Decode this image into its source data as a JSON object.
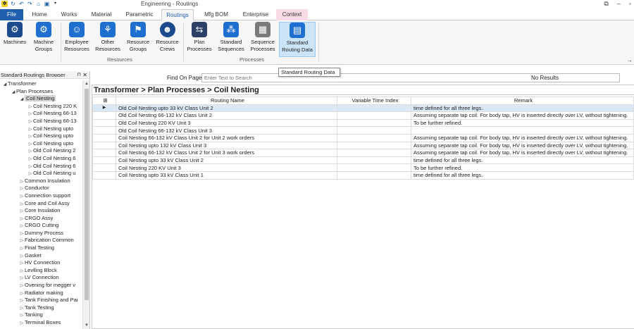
{
  "window": {
    "title": "Engineering - Routings"
  },
  "ribbon_tabs": [
    "File",
    "Home",
    "Works",
    "Material",
    "Parametric",
    "Routings",
    "Mfg BOM",
    "Enterprise",
    "Context"
  ],
  "ribbon": {
    "buttons": [
      {
        "label1": "Machines",
        "label2": "",
        "icon": "machines-icon",
        "color": "#1c4a8c"
      },
      {
        "label1": "Machine",
        "label2": "Groups",
        "icon": "machine-groups-icon",
        "color": "#1f6fd1"
      },
      {
        "label1": "Employee",
        "label2": "Resources",
        "icon": "employee-icon",
        "color": "#1f6fd1"
      },
      {
        "label1": "Other",
        "label2": "Resources",
        "icon": "other-resources-icon",
        "color": "#1f6fd1"
      },
      {
        "label1": "Resource",
        "label2": "Groups",
        "icon": "resource-groups-icon",
        "color": "#1f6fd1"
      },
      {
        "label1": "Resource",
        "label2": "Crews",
        "icon": "crews-icon",
        "color": "#1c4a8c"
      },
      {
        "label1": "Plan",
        "label2": "Processes",
        "icon": "plan-icon",
        "color": "#2e3f66"
      },
      {
        "label1": "Standard",
        "label2": "Sequences",
        "icon": "sequences-icon",
        "color": "#1f6fd1"
      },
      {
        "label1": "Sequence",
        "label2": "Processes",
        "icon": "sequence-processes-icon",
        "color": "#7a7a7a"
      },
      {
        "label1": "Standard",
        "label2": "Routing Data",
        "icon": "routing-data-icon",
        "color": "#1f6fd1"
      }
    ],
    "groups": [
      "Resources",
      "Processes"
    ]
  },
  "tooltip": "Standard Routing Data",
  "left_panel": {
    "title": "Standard Routings Browser",
    "tree": [
      {
        "label": "Transformer",
        "level": 0,
        "expanded": true
      },
      {
        "label": "Plan Processes",
        "level": 1,
        "expanded": true
      },
      {
        "label": "Coil Nesting",
        "level": 2,
        "expanded": true,
        "selected": true
      },
      {
        "label": "Coil Nesting 220 K",
        "level": 3
      },
      {
        "label": "Coil Nesting 66-13",
        "level": 3
      },
      {
        "label": "Coil Nesting 66-13",
        "level": 3
      },
      {
        "label": "Coil Nesting upto",
        "level": 3
      },
      {
        "label": "Coil Nesting upto",
        "level": 3
      },
      {
        "label": "Coil Nesting upto",
        "level": 3
      },
      {
        "label": "Old Coil Nesting 2",
        "level": 3
      },
      {
        "label": "Old Coil Nesting 6",
        "level": 3
      },
      {
        "label": "Old Coil Nesting 6",
        "level": 3
      },
      {
        "label": "Old Coil Nesting u",
        "level": 3
      },
      {
        "label": "Common Insulation",
        "level": 2
      },
      {
        "label": "Conductor",
        "level": 2
      },
      {
        "label": "Connection support",
        "level": 2
      },
      {
        "label": "Core and Coil Assy",
        "level": 2
      },
      {
        "label": "Core Insulation",
        "level": 2
      },
      {
        "label": "CRGO Assy",
        "level": 2
      },
      {
        "label": "CRGO Cutting",
        "level": 2
      },
      {
        "label": "Dummy Process",
        "level": 2
      },
      {
        "label": "Fabrication Common",
        "level": 2
      },
      {
        "label": "Final Testing",
        "level": 2
      },
      {
        "label": "Gasket",
        "level": 2
      },
      {
        "label": "HV Connection",
        "level": 2
      },
      {
        "label": "Levlling Block",
        "level": 2
      },
      {
        "label": "LV Connection",
        "level": 2
      },
      {
        "label": "Ovening for megger v",
        "level": 2
      },
      {
        "label": "Radiator making",
        "level": 2
      },
      {
        "label": "Tank Finishing and Pai",
        "level": 2
      },
      {
        "label": "Tank Testing",
        "level": 2
      },
      {
        "label": "Tanking",
        "level": 2
      },
      {
        "label": "Terminal Boxes",
        "level": 2
      }
    ]
  },
  "find": {
    "label": "Find On Page",
    "placeholder": "Enter Text to Search",
    "results": "No Results"
  },
  "main": {
    "breadcrumb": "Transformer > Plan Processes > Coil Nesting",
    "columns": [
      "Routing Name",
      "Variable Time Index",
      "Remark"
    ],
    "rows": [
      {
        "name": "Old Coil Nesting upto 33 kV Class Unit 2",
        "vti": "",
        "remark": "time defined for all three legs.",
        "selected": true
      },
      {
        "name": "Old Coil Nesting 66-132 kV Class Unit 2",
        "vti": "",
        "remark": "Assuming separate tap coil. For body tap, HV is inserted directly over LV, without tightening."
      },
      {
        "name": "Old Coil Nesting 220 KV  Unit 3",
        "vti": "",
        "remark": "To be further refined."
      },
      {
        "name": "Old Coil Nesting 66-132 kV Class Unit 3",
        "vti": "",
        "remark": ""
      },
      {
        "name": "Coil Nesting 66-132 kV Class Unit 2 for Unit 2 work orders",
        "vti": "",
        "remark": "Assuming separate tap coil. For body tap, HV is inserted directly over LV, without tightening."
      },
      {
        "name": "Coil Nesting upto 132 kV Class Unit 3",
        "vti": "",
        "remark": "Assuming separate tap coil. For body tap, HV is inserted directly over LV, without tightening."
      },
      {
        "name": "Coil Nesting 66-132 kV Class Unit 2 for Unit 3 work orders",
        "vti": "",
        "remark": "Assuming separate tap coil. For body tap, HV is inserted directly over LV, without tightening."
      },
      {
        "name": "Coil Nesting upto 33 kV Class Unit 2",
        "vti": "",
        "remark": "time defined for all three legs."
      },
      {
        "name": "Coil Nesting 220 KV  Unit 3",
        "vti": "",
        "remark": "To be further refined."
      },
      {
        "name": "Coil Nesting upto 33 kV Class Unit 1",
        "vti": "",
        "remark": "time defined for all three legs."
      }
    ]
  },
  "colors": {
    "file_tab": "#1f5fae",
    "context_tab": "#f9dbe8",
    "selected_row": "#dbe8f6",
    "selected_button": "#cce4f7"
  }
}
